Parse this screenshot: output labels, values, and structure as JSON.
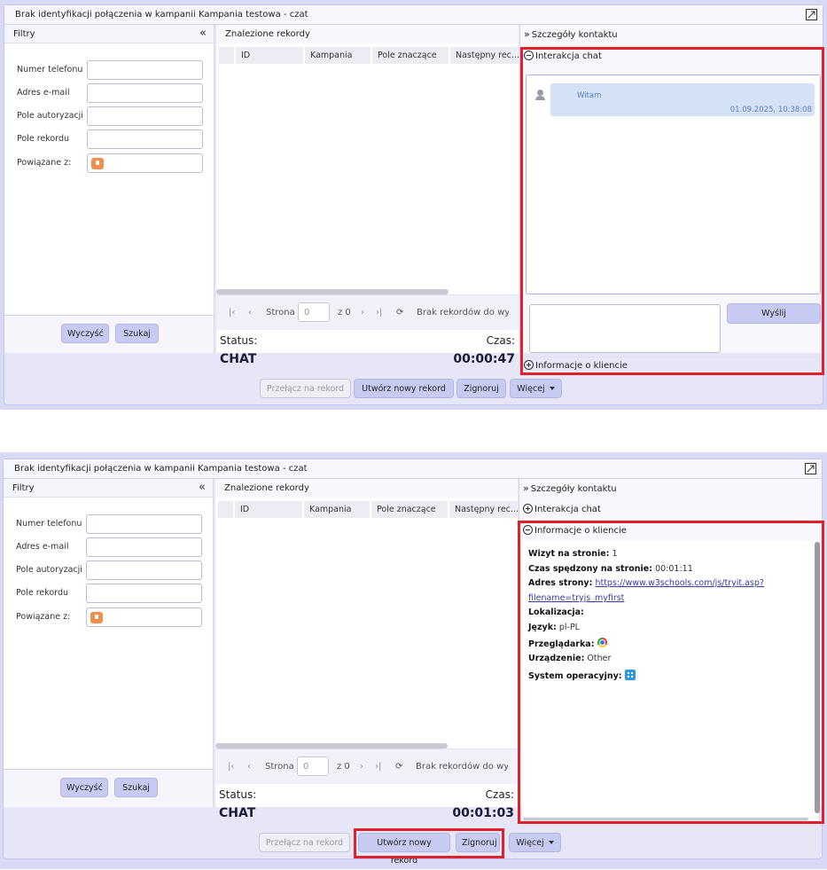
{
  "window": {
    "title": "Brak identyfikacji połączenia w kampanii Kampania testowa - czat"
  },
  "filters": {
    "title": "Filtry",
    "fields": [
      {
        "label": "Numer telefonu",
        "value": ""
      },
      {
        "label": "Adres e-mail",
        "value": ""
      },
      {
        "label": "Pole autoryzacji",
        "value": ""
      },
      {
        "label": "Pole rekordu",
        "value": ""
      },
      {
        "label": "Powiązane z:",
        "value": ""
      }
    ],
    "clear_label": "Wyczyść",
    "search_label": "Szukaj"
  },
  "results": {
    "title": "Znalezione rekordy",
    "columns": [
      "ID",
      "Kampania",
      "Pole znaczące",
      "Następny rec..."
    ],
    "pager": {
      "page_label": "Strona",
      "page_value": "0",
      "of_label": "z 0",
      "empty_text": "Brak rekordów do wyświetlenia"
    },
    "status_label": "Status:",
    "time_label": "Czas:"
  },
  "details": {
    "title": "Szczegóły kontaktu",
    "chat_section": "Interakcja chat",
    "client_section": "Informacje o kliencie",
    "send_label": "Wyślij"
  },
  "chat": {
    "messages": [
      {
        "text": "Witam",
        "time": "01.09.2025, 10:38:08"
      }
    ]
  },
  "client_info": {
    "visit_label": "Wizyt na stronie:",
    "visit_value": "1",
    "time_label": "Czas spędzony na stronie:",
    "time_value": "00:01:11",
    "url_label": "Adres strony:",
    "url_line1": "https://www.w3schools.com/js/tryit.asp?",
    "url_line2": "filename=tryjs_myfirst",
    "location_label": "Lokalizacja:",
    "language_label": "Język:",
    "language_value": "pl-PL",
    "browser_label": "Przeglądarka:",
    "browser_icon": "chrome-icon",
    "device_label": "Urządzenie:",
    "device_value": "Other",
    "os_label": "System operacyjny:",
    "os_icon": "windows-icon"
  },
  "footer": {
    "link_label": "Przełącz na rekord",
    "create_label": "Utwórz nowy rekord",
    "ignore_label": "Zignoruj",
    "more_label": "Więcej"
  },
  "screens": [
    {
      "status_value": "CHAT",
      "time_value": "00:00:47"
    },
    {
      "status_value": "CHAT",
      "time_value": "00:01:03"
    }
  ],
  "colors": {
    "highlight": "#e0202a",
    "button_bg": "#c7caf1",
    "chat_bubble": "#d5e2f5"
  }
}
